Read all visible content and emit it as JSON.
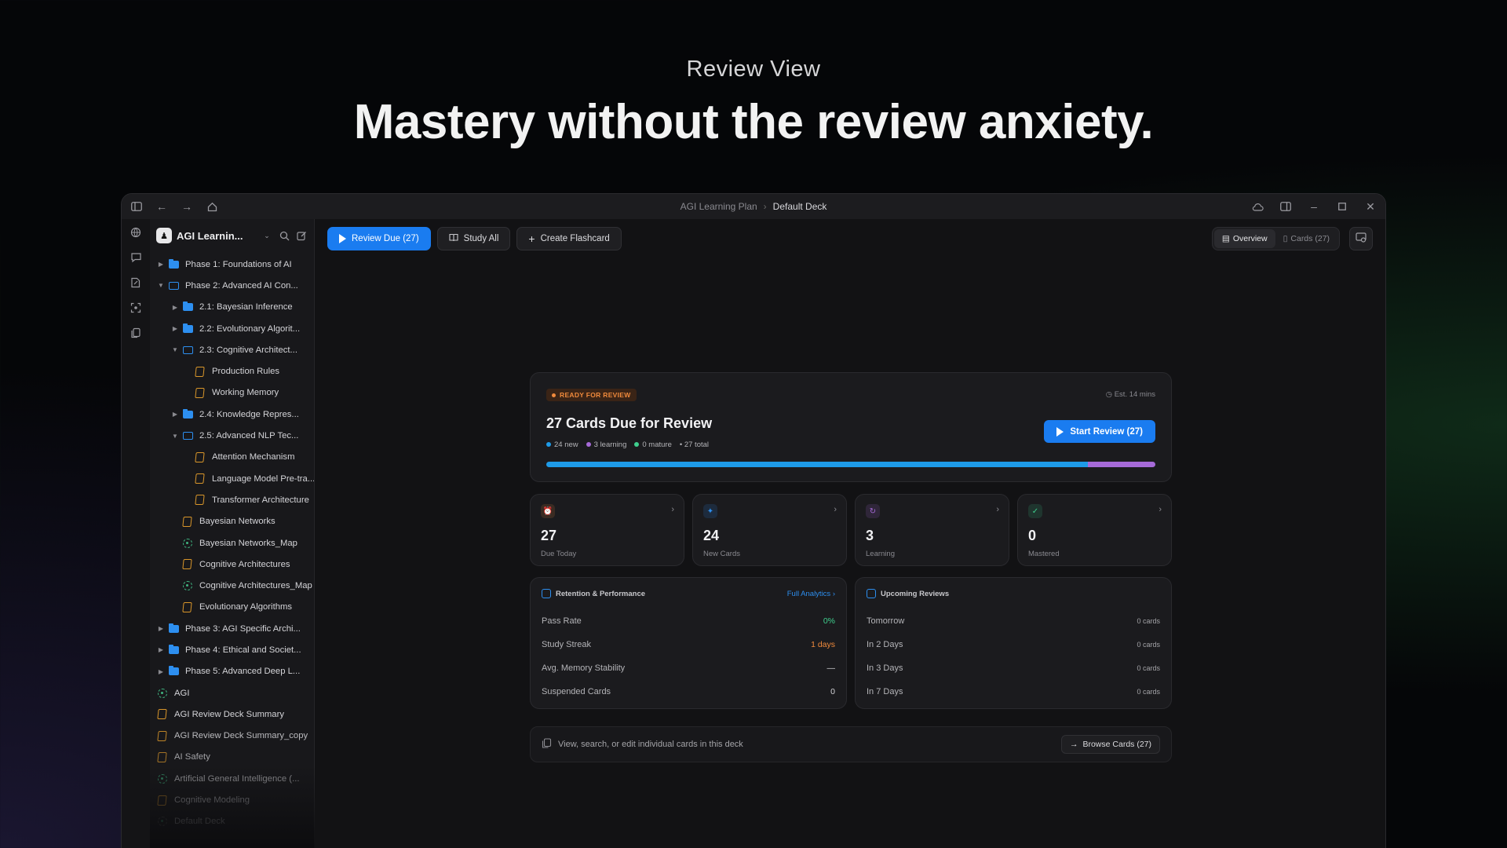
{
  "hero": {
    "subtitle": "Review View",
    "title": "Mastery without the review anxiety."
  },
  "titlebar": {
    "breadcrumb_parent": "AGI Learning Plan",
    "breadcrumb_current": "Default Deck"
  },
  "sidebar": {
    "workspace_name": "AGI Learnin...",
    "items": [
      {
        "label": "Phase 1: Foundations of AI",
        "type": "folder",
        "depth": 1,
        "caret": "collapsed"
      },
      {
        "label": "Phase 2: Advanced AI Con...",
        "type": "folder-open",
        "depth": 1,
        "caret": "expanded"
      },
      {
        "label": "2.1: Bayesian Inference",
        "type": "folder",
        "depth": 2,
        "caret": "collapsed"
      },
      {
        "label": "2.2: Evolutionary Algorit...",
        "type": "folder",
        "depth": 2,
        "caret": "collapsed"
      },
      {
        "label": "2.3: Cognitive Architect...",
        "type": "folder-open",
        "depth": 2,
        "caret": "expanded"
      },
      {
        "label": "Production Rules",
        "type": "note",
        "depth": 3,
        "caret": "none"
      },
      {
        "label": "Working Memory",
        "type": "note",
        "depth": 3,
        "caret": "none"
      },
      {
        "label": "2.4: Knowledge Repres...",
        "type": "folder",
        "depth": 2,
        "caret": "collapsed"
      },
      {
        "label": "2.5: Advanced NLP Tec...",
        "type": "folder-open",
        "depth": 2,
        "caret": "expanded"
      },
      {
        "label": "Attention Mechanism",
        "type": "note",
        "depth": 3,
        "caret": "none"
      },
      {
        "label": "Language Model Pre-tra...",
        "type": "note",
        "depth": 3,
        "caret": "none"
      },
      {
        "label": "Transformer Architecture",
        "type": "note",
        "depth": 3,
        "caret": "none"
      },
      {
        "label": "Bayesian Networks",
        "type": "note",
        "depth": 2,
        "caret": "none"
      },
      {
        "label": "Bayesian Networks_Map",
        "type": "map",
        "depth": 2,
        "caret": "none"
      },
      {
        "label": "Cognitive Architectures",
        "type": "note",
        "depth": 2,
        "caret": "none"
      },
      {
        "label": "Cognitive Architectures_Map",
        "type": "map",
        "depth": 2,
        "caret": "none"
      },
      {
        "label": "Evolutionary Algorithms",
        "type": "note",
        "depth": 2,
        "caret": "none"
      },
      {
        "label": "Phase 3: AGI Specific Archi...",
        "type": "folder",
        "depth": 1,
        "caret": "collapsed"
      },
      {
        "label": "Phase 4: Ethical and Societ...",
        "type": "folder",
        "depth": 1,
        "caret": "collapsed"
      },
      {
        "label": "Phase 5: Advanced Deep L...",
        "type": "folder",
        "depth": 1,
        "caret": "collapsed"
      },
      {
        "label": "AGI",
        "type": "map",
        "depth": 0,
        "caret": "none"
      },
      {
        "label": "AGI Review Deck Summary",
        "type": "note",
        "depth": 0,
        "caret": "none"
      },
      {
        "label": "AGI Review Deck Summary_copy",
        "type": "note",
        "depth": 0,
        "caret": "none"
      },
      {
        "label": "AI Safety",
        "type": "note",
        "depth": 0,
        "caret": "none"
      },
      {
        "label": "Artificial General Intelligence (...",
        "type": "map",
        "depth": 0,
        "caret": "none"
      },
      {
        "label": "Cognitive Modeling",
        "type": "note",
        "depth": 0,
        "caret": "none"
      },
      {
        "label": "Default Deck",
        "type": "deck",
        "depth": 0,
        "caret": "none"
      }
    ]
  },
  "toolbar": {
    "review_due_label": "Review Due (27)",
    "study_all_label": "Study All",
    "create_flashcard_label": "Create Flashcard",
    "tab_overview": "Overview",
    "tab_cards": "Cards (27)"
  },
  "review": {
    "badge": "READY FOR REVIEW",
    "estimate": "Est. 14 mins",
    "title": "27 Cards Due for Review",
    "stat_new": "24 new",
    "stat_learning": "3 learning",
    "stat_mature": "0 mature",
    "stat_total": "27 total",
    "start_label": "Start Review (27)",
    "progress_new_fraction": 0.889,
    "progress_learning_fraction": 0.111
  },
  "stat_cards": [
    {
      "value": "27",
      "label": "Due Today",
      "icon": "alarm-icon",
      "color": "#f08a3c"
    },
    {
      "value": "24",
      "label": "New Cards",
      "icon": "sparkle-icon",
      "color": "#2d8ff0"
    },
    {
      "value": "3",
      "label": "Learning",
      "icon": "refresh-icon",
      "color": "#a66ad8"
    },
    {
      "value": "0",
      "label": "Mastered",
      "icon": "check-icon",
      "color": "#3fcf8e"
    }
  ],
  "retention": {
    "title": "Retention & Performance",
    "link": "Full Analytics",
    "rows": [
      {
        "label": "Pass Rate",
        "value": "0%"
      },
      {
        "label": "Study Streak",
        "value": "1 days"
      },
      {
        "label": "Avg. Memory Stability",
        "value": "—"
      },
      {
        "label": "Suspended Cards",
        "value": "0"
      }
    ]
  },
  "upcoming": {
    "title": "Upcoming Reviews",
    "rows": [
      {
        "label": "Tomorrow",
        "value": "0 cards"
      },
      {
        "label": "In 2 Days",
        "value": "0 cards"
      },
      {
        "label": "In 3 Days",
        "value": "0 cards"
      },
      {
        "label": "In 7 Days",
        "value": "0 cards"
      }
    ]
  },
  "browse": {
    "text": "View, search, or edit individual cards in this deck",
    "button": "Browse Cards (27)"
  },
  "colors": {
    "accent": "#1a7cf0",
    "new": "#1e9be8",
    "learning": "#a66ad8",
    "mature": "#3fcf8e",
    "due": "#f08a3c"
  }
}
